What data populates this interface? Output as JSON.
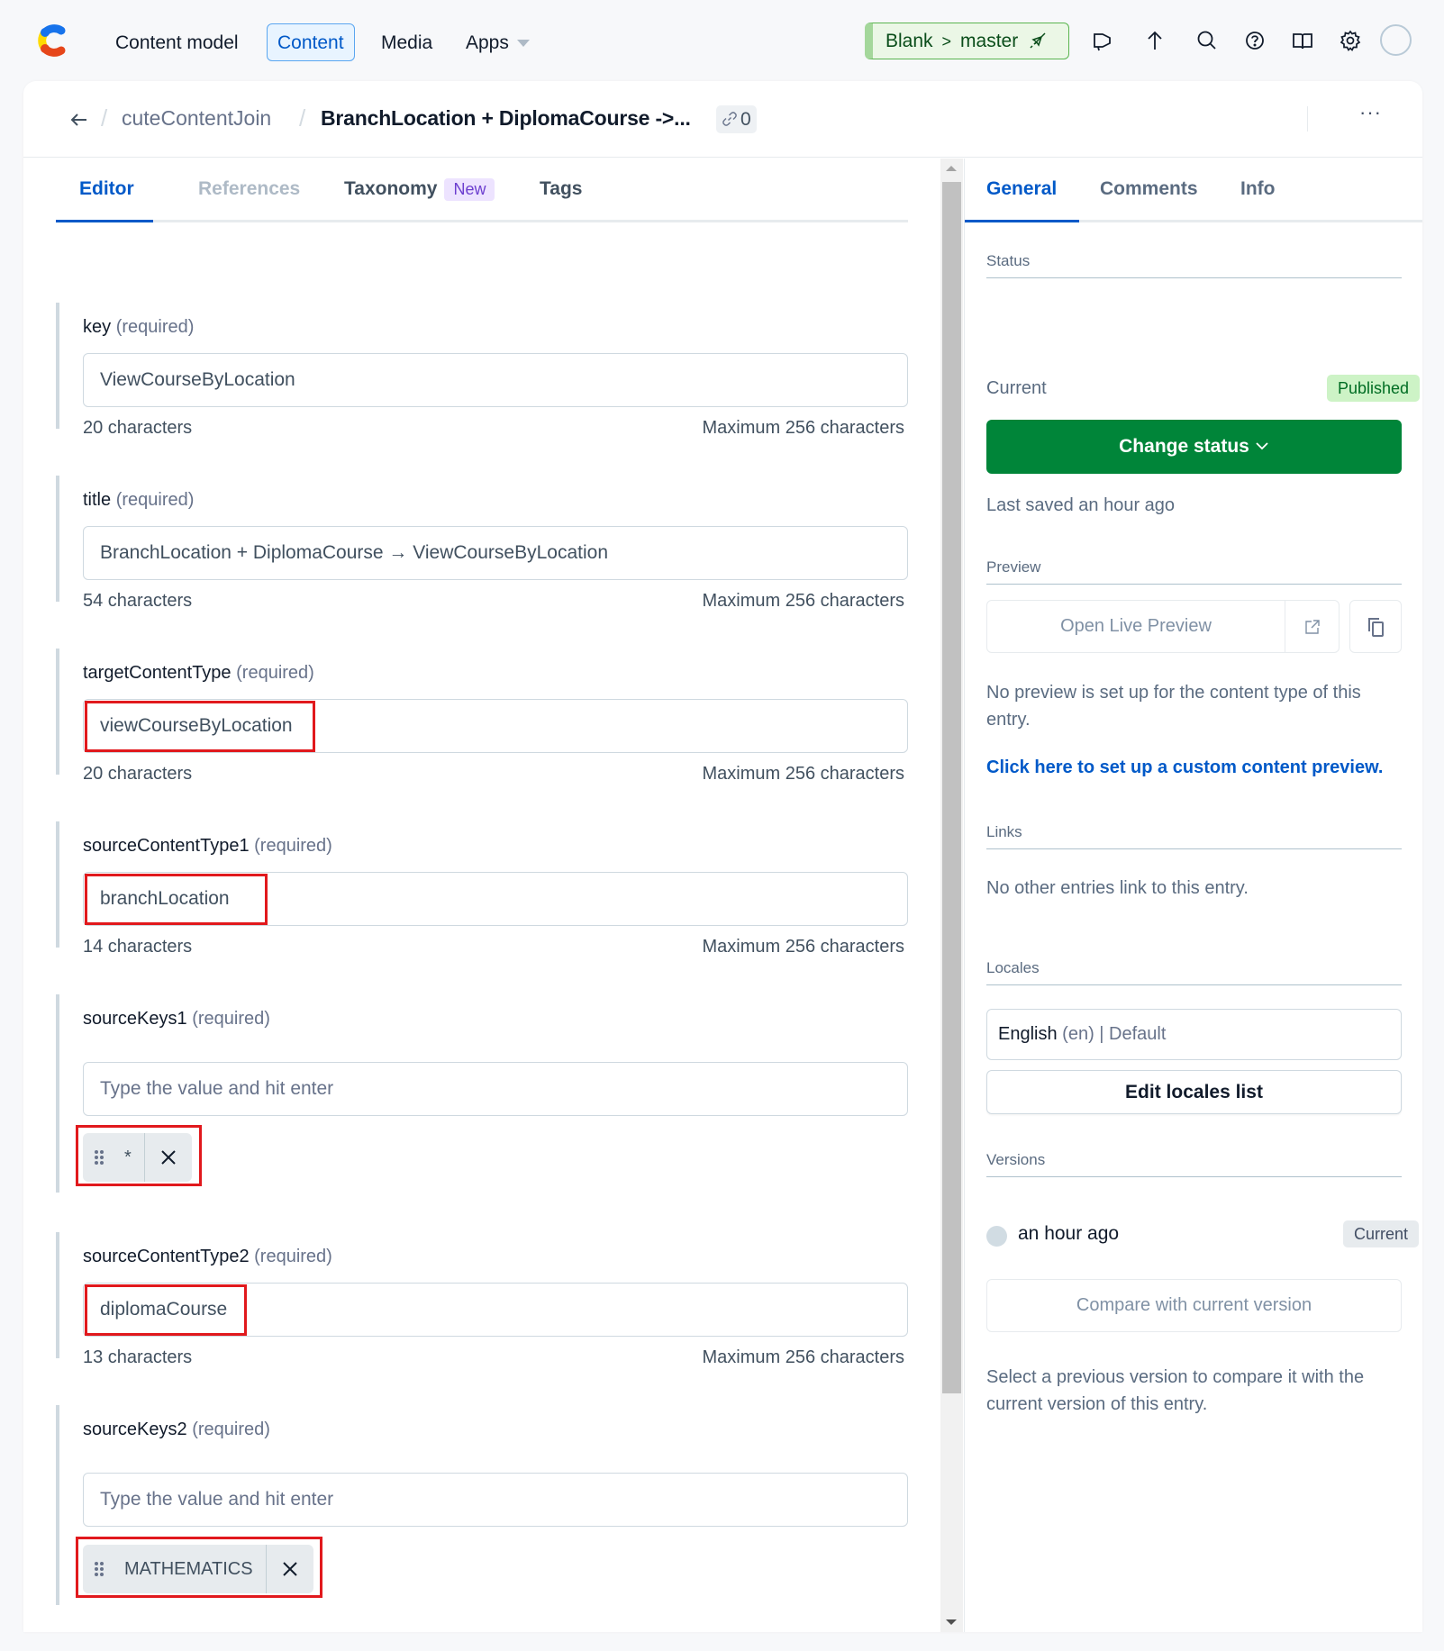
{
  "topnav": {
    "items": [
      {
        "label": "Content model",
        "active": false
      },
      {
        "label": "Content",
        "active": true
      },
      {
        "label": "Media",
        "active": false
      },
      {
        "label": "Apps",
        "active": false
      }
    ],
    "environment": {
      "space": "Blank",
      "branch": "master"
    },
    "icons": [
      "megaphone-icon",
      "upload-icon",
      "search-icon",
      "help-icon",
      "docs-book-icon",
      "settings-gear-icon",
      "user-avatar"
    ]
  },
  "header": {
    "breadcrumb_parent": "cuteContentJoin",
    "entry_title": "BranchLocation + DiplomaCourse ->...",
    "reference_count": "0",
    "more_label": "···"
  },
  "editor": {
    "tabs": [
      {
        "label": "Editor",
        "state": "active"
      },
      {
        "label": "References",
        "state": "disabled"
      },
      {
        "label": "Taxonomy",
        "badge": "New",
        "state": "normal"
      },
      {
        "label": "Tags",
        "state": "normal"
      }
    ],
    "fields": [
      {
        "name": "key",
        "required": "(required)",
        "value": "ViewCourseByLocation",
        "count": "20 characters",
        "max": "Maximum 256 characters"
      },
      {
        "name": "title",
        "required": "(required)",
        "value": "BranchLocation + DiplomaCourse → ViewCourseByLocation",
        "count": "54 characters",
        "max": "Maximum 256 characters"
      },
      {
        "name": "targetContentType",
        "required": "(required)",
        "value": "viewCourseByLocation",
        "count": "20 characters",
        "max": "Maximum 256 characters"
      },
      {
        "name": "sourceContentType1",
        "required": "(required)",
        "value": "branchLocation",
        "count": "14 characters",
        "max": "Maximum 256 characters"
      },
      {
        "name": "sourceKeys1",
        "required": "(required)",
        "placeholder": "Type the value and hit enter",
        "tags": [
          "*"
        ]
      },
      {
        "name": "sourceContentType2",
        "required": "(required)",
        "value": "diplomaCourse",
        "count": "13 characters",
        "max": "Maximum 256 characters"
      },
      {
        "name": "sourceKeys2",
        "required": "(required)",
        "placeholder": "Type the value and hit enter",
        "tags": [
          "MATHEMATICS"
        ]
      }
    ]
  },
  "sidebar": {
    "tabs": [
      {
        "label": "General",
        "active": true
      },
      {
        "label": "Comments",
        "active": false
      },
      {
        "label": "Info",
        "active": false
      }
    ],
    "status": {
      "title": "Status",
      "current_label": "Current",
      "badge": "Published",
      "change_button": "Change status",
      "last_saved": "Last saved an hour ago"
    },
    "preview": {
      "title": "Preview",
      "open_button": "Open Live Preview",
      "message": "No preview is set up for the content type of this entry.",
      "link": "Click here to set up a custom content preview."
    },
    "links": {
      "title": "Links",
      "message": "No other entries link to this entry."
    },
    "locales": {
      "title": "Locales",
      "locale_name": "English",
      "locale_code": "(en) | Default",
      "edit_button": "Edit locales list"
    },
    "versions": {
      "title": "Versions",
      "entry_label": "an hour ago",
      "entry_badge": "Current",
      "compare_button": "Compare with current version",
      "help": "Select a previous version to compare it with the current version of this entry."
    }
  },
  "colors": {
    "accent_blue": "#0059c8",
    "primary_green": "#008539",
    "published_bg": "#cdf3c6",
    "highlight_red": "#e1191d"
  }
}
